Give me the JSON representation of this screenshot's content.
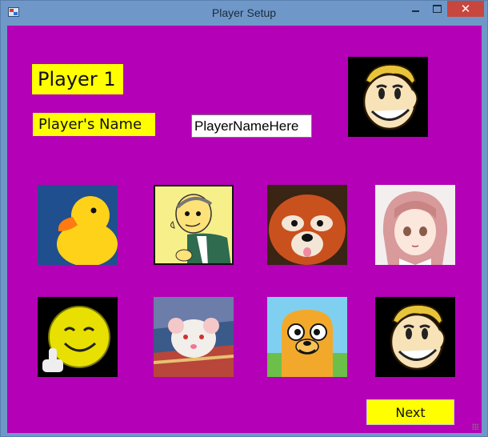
{
  "window": {
    "title": "Player Setup",
    "close_glyph": "✕"
  },
  "labels": {
    "player": "Player 1",
    "name": "Player's Name"
  },
  "name_input": {
    "value": "PlayerNameHere"
  },
  "avatars": [
    {
      "icon": "rubber-duck-icon"
    },
    {
      "icon": "mr-burns-icon"
    },
    {
      "icon": "red-panda-icon"
    },
    {
      "icon": "anime-girl-icon"
    },
    {
      "icon": "smiley-finger-icon"
    },
    {
      "icon": "rat-icon"
    },
    {
      "icon": "jake-the-dog-icon"
    },
    {
      "icon": "vault-boy-icon"
    }
  ],
  "buttons": {
    "next": "Next"
  },
  "colors": {
    "background": "#b400b6",
    "label_background": "#ffff00",
    "title_bar": "#6f98c8",
    "close_button": "#c7463d"
  }
}
